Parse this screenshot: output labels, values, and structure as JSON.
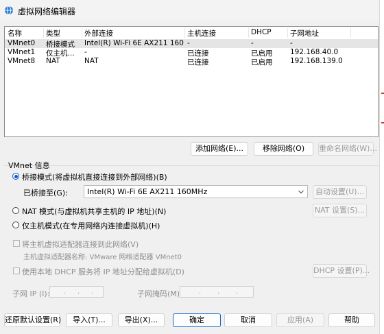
{
  "window": {
    "title": "虚拟网络编辑器"
  },
  "table": {
    "headers": [
      "名称",
      "类型",
      "外部连接",
      "主机连接",
      "DHCP",
      "子网地址"
    ],
    "rows": [
      [
        "VMnet0",
        "桥接模式",
        "Intel(R) Wi-Fi 6E AX211 160...",
        "-",
        "-",
        "-"
      ],
      [
        "VMnet1",
        "仅主机...",
        "-",
        "已连接",
        "已启用",
        "192.168.40.0"
      ],
      [
        "VMnet8",
        "NAT",
        "NAT",
        "已连接",
        "已启用",
        "192.168.139.0"
      ]
    ]
  },
  "list_buttons": {
    "add": "添加网络(E)...",
    "remove": "移除网络(O)",
    "rename": "重命名网络(W)..."
  },
  "vmnet_info": {
    "title": "VMnet 信息",
    "bridge_radio": "桥接模式(将虚拟机直接连接到外部网络)(B)",
    "bridged_to_label": "已桥接至(G):",
    "bridged_to_value": "Intel(R) Wi-Fi 6E AX211 160MHz",
    "auto_settings": "自动设置(U)...",
    "nat_radio": "NAT 模式(与虚拟机共享主机的 IP 地址)(N)",
    "nat_settings": "NAT 设置(S)...",
    "hostonly_radio": "仅主机模式(在专用网络内连接虚拟机)(H)",
    "connect_adapter": "将主机虚拟适配器连接到此网络(V)",
    "adapter_name": "主机虚拟适配器名称: VMware 网络适配器 VMnet0",
    "use_dhcp": "使用本地 DHCP 服务将 IP 地址分配给虚拟机(D)",
    "dhcp_settings": "DHCP 设置(P)...",
    "subnet_ip_label": "子网 IP (I):",
    "subnet_mask_label": "子网掩码(M):"
  },
  "footer": {
    "restore": "还原默认设置(R)",
    "import": "导入(T)...",
    "export": "导出(X)...",
    "ok": "确定",
    "cancel": "取消",
    "apply": "应用(A)",
    "help": "帮助"
  }
}
